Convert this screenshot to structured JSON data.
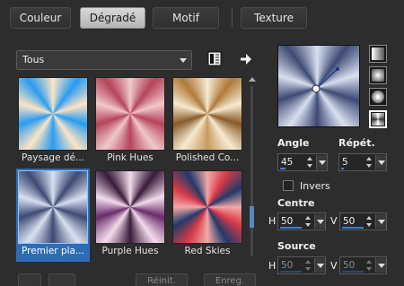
{
  "tabs": [
    {
      "label": "Couleur",
      "active": false
    },
    {
      "label": "Dégradé",
      "active": true
    },
    {
      "label": "Motif",
      "active": false
    },
    {
      "label": "Texture",
      "active": false
    }
  ],
  "category": {
    "selected": "Tous"
  },
  "icons": {
    "library": "library-icon",
    "arrow": "right-arrow-icon"
  },
  "gallery": {
    "items": [
      {
        "name": "Paysage dé...",
        "selected": false
      },
      {
        "name": "Pink Hues",
        "selected": false
      },
      {
        "name": "Polished Co...",
        "selected": false
      },
      {
        "name": "Premier pla...",
        "selected": true
      },
      {
        "name": "Purple Hues",
        "selected": false
      },
      {
        "name": "Red Skies",
        "selected": false
      }
    ]
  },
  "buttons": {
    "reset": "Réinit.",
    "save": "Enreg."
  },
  "params": {
    "angle_label": "Angle",
    "angle_value": "45",
    "repeat_label": "Répét.",
    "repeat_value": "5",
    "invert_label": "Invers",
    "invert_checked": false,
    "center_label": "Centre",
    "center_h_label": "H",
    "center_h": "50",
    "center_v_label": "V",
    "center_v": "50",
    "source_label": "Source",
    "source_h_label": "H",
    "source_h": "50",
    "source_v_label": "V",
    "source_v": "50"
  },
  "colors": {
    "accent": "#3c7fd8",
    "selection": "#2e6db4"
  }
}
